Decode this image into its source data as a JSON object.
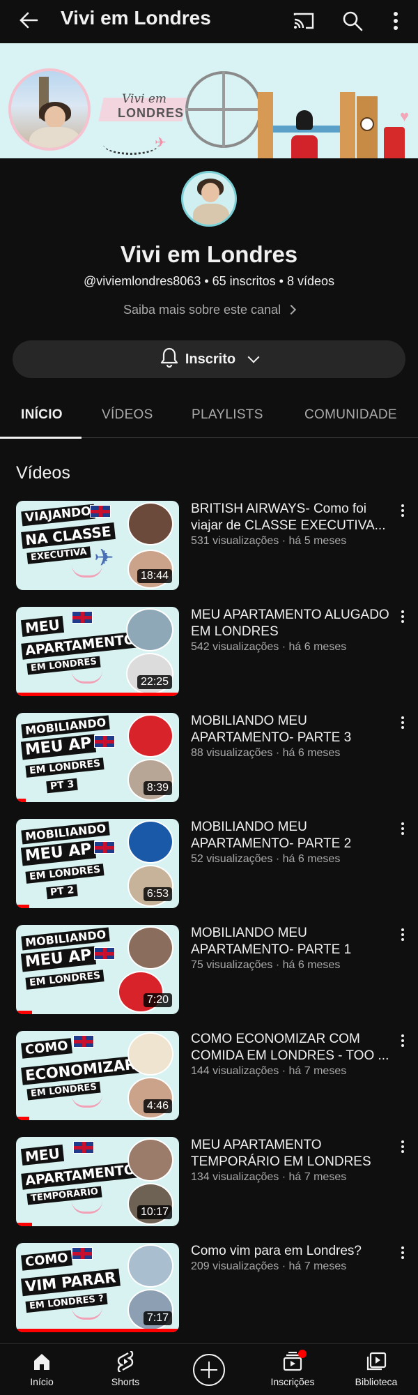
{
  "topbar": {
    "title": "Vivi em Londres",
    "icons": [
      "back-arrow-icon",
      "cast-icon",
      "search-icon",
      "more-vertical-icon"
    ]
  },
  "banner": {
    "brand_line1": "Vivi em",
    "brand_line2": "LONDRES"
  },
  "channel": {
    "name": "Vivi em Londres",
    "meta": "@viviemlondres8063 • 65 inscritos • 8 vídeos",
    "more_link": "Saiba mais sobre este canal",
    "subscribe_label": "Inscrito"
  },
  "tabs": [
    {
      "label": "INÍCIO",
      "active": true
    },
    {
      "label": "VÍDEOS",
      "active": false
    },
    {
      "label": "PLAYLISTS",
      "active": false
    },
    {
      "label": "COMUNIDADE",
      "active": false
    }
  ],
  "section_title": "Vídeos",
  "videos": [
    {
      "title": "BRITISH AIRWAYS- Como foi viajar de CLASSE EXECUTIVA...",
      "meta": "531 visualizações · há 5 meses",
      "duration": "18:44",
      "thumb_text": [
        "VIAJANDO",
        "NA CLASSE",
        "EXECUTIVA"
      ],
      "watched": 0
    },
    {
      "title": "MEU APARTAMENTO ALUGADO EM LONDRES",
      "meta": "542 visualizações · há 6 meses",
      "duration": "22:25",
      "thumb_text": [
        "MEU",
        "APARTAMENTO",
        "EM LONDRES"
      ],
      "watched": 1.0
    },
    {
      "title": "MOBILIANDO MEU APARTAMENTO- PARTE 3",
      "meta": "88 visualizações · há 6 meses",
      "duration": "8:39",
      "thumb_text": [
        "MOBILIANDO",
        "MEU AP",
        "EM LONDRES",
        "PT 3"
      ],
      "watched": 0.06
    },
    {
      "title": "MOBILIANDO MEU APARTAMENTO- PARTE 2",
      "meta": "52 visualizações · há 6 meses",
      "duration": "6:53",
      "thumb_text": [
        "MOBILIANDO",
        "MEU AP",
        "EM LONDRES",
        "PT 2"
      ],
      "watched": 0.08
    },
    {
      "title": "MOBILIANDO MEU APARTAMENTO- PARTE 1",
      "meta": "75 visualizações · há 6 meses",
      "duration": "7:20",
      "thumb_text": [
        "MOBILIANDO",
        "MEU AP",
        "EM LONDRES"
      ],
      "watched": 0.1
    },
    {
      "title": "COMO ECONOMIZAR COM COMIDA EM LONDRES - TOO ...",
      "meta": "144 visualizações · há 7 meses",
      "duration": "4:46",
      "thumb_text": [
        "COMO",
        "ECONOMIZAR",
        "EM LONDRES"
      ],
      "watched": 0.08
    },
    {
      "title": "MEU APARTAMENTO TEMPORÁRIO EM LONDRES",
      "meta": "134 visualizações · há 7 meses",
      "duration": "10:17",
      "thumb_text": [
        "MEU",
        "APARTAMENTO",
        "TEMPORÁRIO"
      ],
      "watched": 0.1
    },
    {
      "title": "Como vim para em Londres?",
      "meta": "209 visualizações · há 7 meses",
      "duration": "7:17",
      "thumb_text": [
        "COMO",
        "VIM PARAR",
        "EM LONDRES ?"
      ],
      "watched": 1.0
    }
  ],
  "bottomnav": [
    {
      "label": "Início",
      "icon": "home-icon"
    },
    {
      "label": "Shorts",
      "icon": "shorts-icon"
    },
    {
      "label": "",
      "icon": "create-icon"
    },
    {
      "label": "Inscrições",
      "icon": "subscriptions-icon"
    },
    {
      "label": "Biblioteca",
      "icon": "library-icon"
    }
  ],
  "colors": {
    "background": "#0f0f0f",
    "surface": "#272727",
    "text_primary": "#f1f1f1",
    "text_secondary": "#aaaaaa",
    "accent_red": "#ff0000",
    "thumb_bg": "#d7f2f1"
  }
}
